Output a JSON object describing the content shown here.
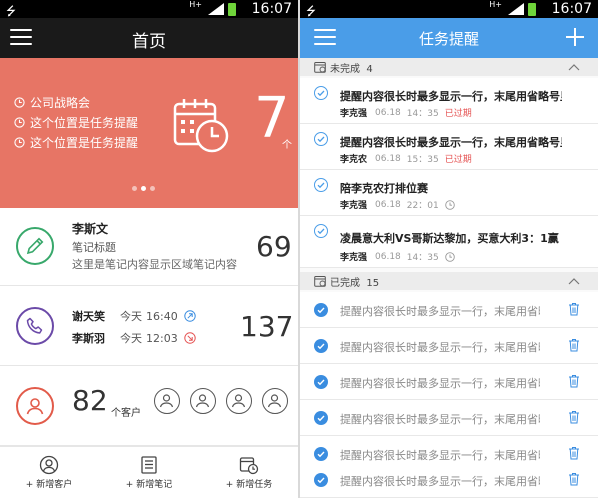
{
  "status": {
    "time": "16:07",
    "network": "H+"
  },
  "left": {
    "header": {
      "title": "首页"
    },
    "banner": {
      "reminders": [
        "公司战略会",
        "这个位置是任务提醒",
        "这个位置是任务提醒"
      ],
      "count": "7",
      "unit": "个"
    },
    "note": {
      "name": "李斯文",
      "title": "笔记标题",
      "content": "这里是笔记内容显示区域笔记内容",
      "count": "69"
    },
    "calls": {
      "items": [
        {
          "name": "谢天笑",
          "day": "今天",
          "time": "16:40"
        },
        {
          "name": "李斯羽",
          "day": "今天",
          "time": "12:03"
        }
      ],
      "count": "137"
    },
    "customers": {
      "count": "82",
      "unit": "个客户"
    },
    "footer": {
      "add_customer": "+ 新增客户",
      "add_note": "+ 新增笔记",
      "add_task": "+ 新增任务"
    }
  },
  "right": {
    "header": {
      "title": "任务提醒"
    },
    "pending": {
      "label": "未完成",
      "count": "4",
      "tasks": [
        {
          "title": "提醒内容很长时最多显示一行，末尾用省略号显示",
          "person": "李克强",
          "date": "06.18",
          "time": "14：35",
          "status": "已过期"
        },
        {
          "title": "提醒内容很长时最多显示一行，末尾用省略号显示",
          "person": "李克农",
          "date": "06.18",
          "time": "15：35",
          "status": "已过期"
        },
        {
          "title": "陪李克农打排位赛",
          "person": "李克强",
          "date": "06.18",
          "time": "22：01",
          "status": ""
        },
        {
          "title": "凌晨意大利VS哥斯达黎加，买意大利3：1赢",
          "person": "李克强",
          "date": "06.18",
          "time": "14：35",
          "status": ""
        }
      ]
    },
    "done": {
      "label": "已完成",
      "count": "15",
      "tasks": [
        "提醒内容很长时最多显示一行，末尾用省略号显示",
        "提醒内容很长时最多显示一行，末尾用省略号显示",
        "提醒内容很长时最多显示一行，末尾用省略号显示",
        "提醒内容很长时最多显示一行，末尾用省略号显示",
        "提醒内容很长时最多显示一行，末尾用省略号显示",
        "提醒内容很长时最多显示一行，末尾用省略号显示"
      ]
    }
  },
  "colors": {
    "banner": "#e77565",
    "right_header": "#4a9de8",
    "note_icon": "#38a86b",
    "call_icon": "#6b4aa8",
    "customer_icon": "#e25b4a",
    "overdue": "#e55353",
    "check": "#3a8de0"
  }
}
